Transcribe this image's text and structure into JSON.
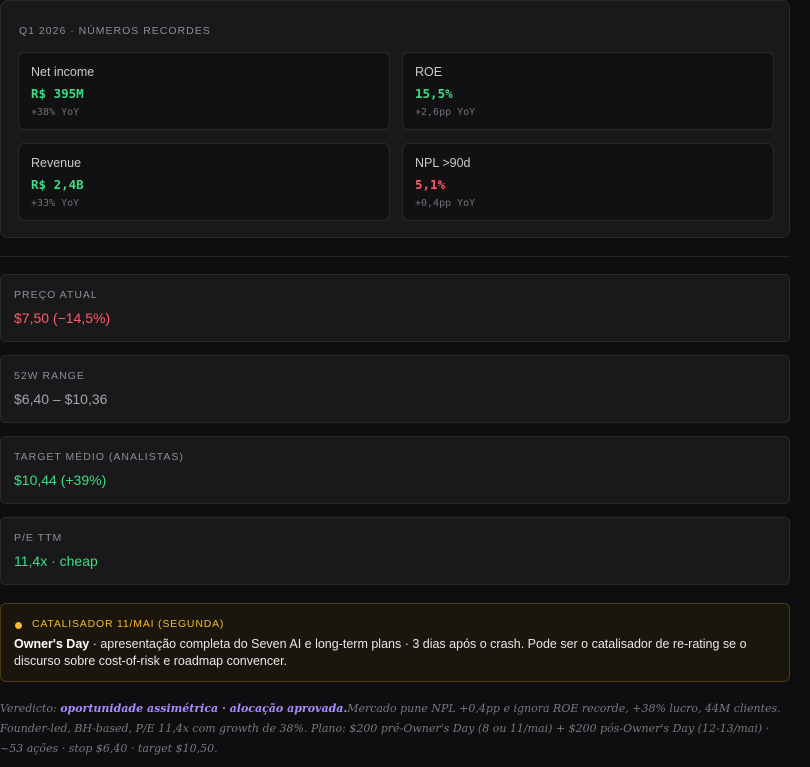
{
  "panel": {
    "title": "Q1 2026 · NÚMEROS RECORDES",
    "kpis": [
      {
        "label": "Net income",
        "value": "R$ 395M",
        "delta": "+38% YoY",
        "tone": "green"
      },
      {
        "label": "ROE",
        "value": "15,5%",
        "delta": "+2,6pp YoY",
        "tone": "green"
      },
      {
        "label": "Revenue",
        "value": "R$ 2,4B",
        "delta": "+33% YoY",
        "tone": "green"
      },
      {
        "label": "NPL >90d",
        "value": "5,1%",
        "delta": "+0,4pp YoY",
        "tone": "red"
      }
    ]
  },
  "stats": [
    {
      "label": "PREÇO ATUAL",
      "value": "$7,50 (−14,5%)",
      "tone": "red"
    },
    {
      "label": "52W RANGE",
      "value": "$6,40 – $10,36",
      "tone": "grey"
    },
    {
      "label": "TARGET MÉDIO (ANALISTAS)",
      "value": "$10,44 (+39%)",
      "tone": "green"
    },
    {
      "label": "P/E TTM",
      "value": "11,4x · cheap",
      "tone": "green"
    }
  ],
  "catalyst": {
    "title": "CATALISADOR 11/MAI (SEGUNDA)",
    "highlight": "Owner's Day",
    "text": " · apresentação completa do Seven AI e long-term plans · 3 dias após o crash. Pode ser o catalisador de re-rating se o discurso sobre cost-of-risk e roadmap convencer."
  },
  "verdict": {
    "prefix": "Veredicto: ",
    "highlight": "oportunidade assimétrica · alocação aprovada.",
    "text": "Mercado pune NPL +0,4pp e ignora ROE recorde, +38% lucro, 44M clientes. Founder-led, BH-based, P/E 11,4x com growth de 38%. Plano: $200 pré-Owner's Day (8 ou 11/mai) + $200 pós-Owner's Day (12-13/mai) · ~53 ações · stop $6,40 · target $10,50."
  },
  "colors": {
    "green": "#3ddc84",
    "red": "#ff5a6a",
    "amber": "#f5b82e",
    "purple": "#a98bff"
  }
}
